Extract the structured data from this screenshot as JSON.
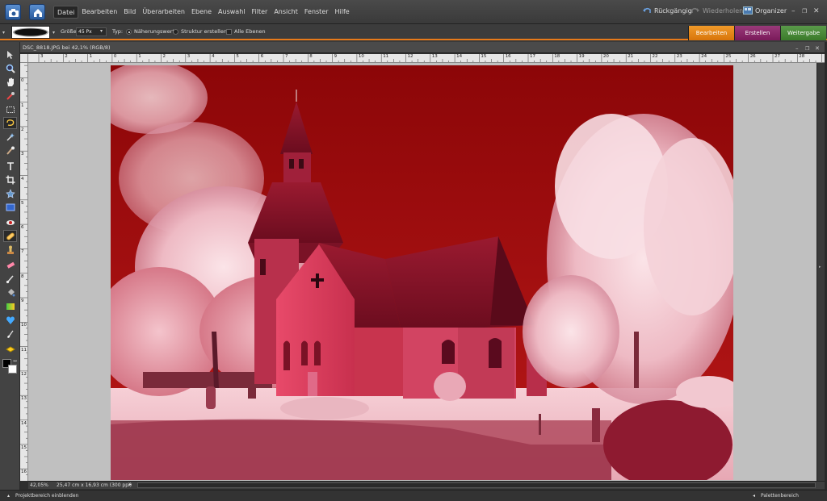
{
  "menubar": {
    "items": [
      "Datei",
      "Bearbeiten",
      "Bild",
      "Überarbeiten",
      "Ebene",
      "Auswahl",
      "Filter",
      "Ansicht",
      "Fenster",
      "Hilfe"
    ],
    "undo_label": "Rückgängig",
    "redo_label": "Wiederholen",
    "organizer_label": "Organizer"
  },
  "options": {
    "size_label": "Größe:",
    "size_value": "45 Px",
    "type_label": "Typ:",
    "type_option1": "Näherungswert",
    "type_option2": "Struktur erstellen",
    "all_layers": "Alle Ebenen"
  },
  "modes": {
    "edit": "Bearbeiten",
    "create": "Erstellen",
    "share": "Weitergabe"
  },
  "document": {
    "title": "DSC_8818.JPG bei 42,1% (RGB/8)",
    "zoom": "42,05%",
    "dimensions": "25,47 cm x 16,93 cm (300 ppi)"
  },
  "ruler": {
    "h_labels": [
      "3",
      "2",
      "1",
      "0",
      "1",
      "2",
      "3",
      "4",
      "5",
      "6",
      "7",
      "8",
      "9",
      "10",
      "11",
      "12",
      "13",
      "14",
      "15",
      "16",
      "17",
      "18",
      "19",
      "20",
      "21",
      "22",
      "23",
      "24",
      "25",
      "26",
      "27",
      "28"
    ],
    "v_labels": [
      "1",
      "0",
      "1",
      "2",
      "3",
      "4",
      "5",
      "6",
      "7",
      "8",
      "9",
      "10",
      "11",
      "12",
      "13",
      "14",
      "15",
      "16",
      "17"
    ]
  },
  "bottom": {
    "project_bin": "Projektbereich einblenden",
    "palette_bin": "Palettenbereich"
  },
  "colors": {
    "accent": "#e87a1a",
    "edit_tab": "#e8840e",
    "create_tab": "#8a2a6a",
    "share_tab": "#4a8a3a",
    "sky": "#a00a0a"
  }
}
